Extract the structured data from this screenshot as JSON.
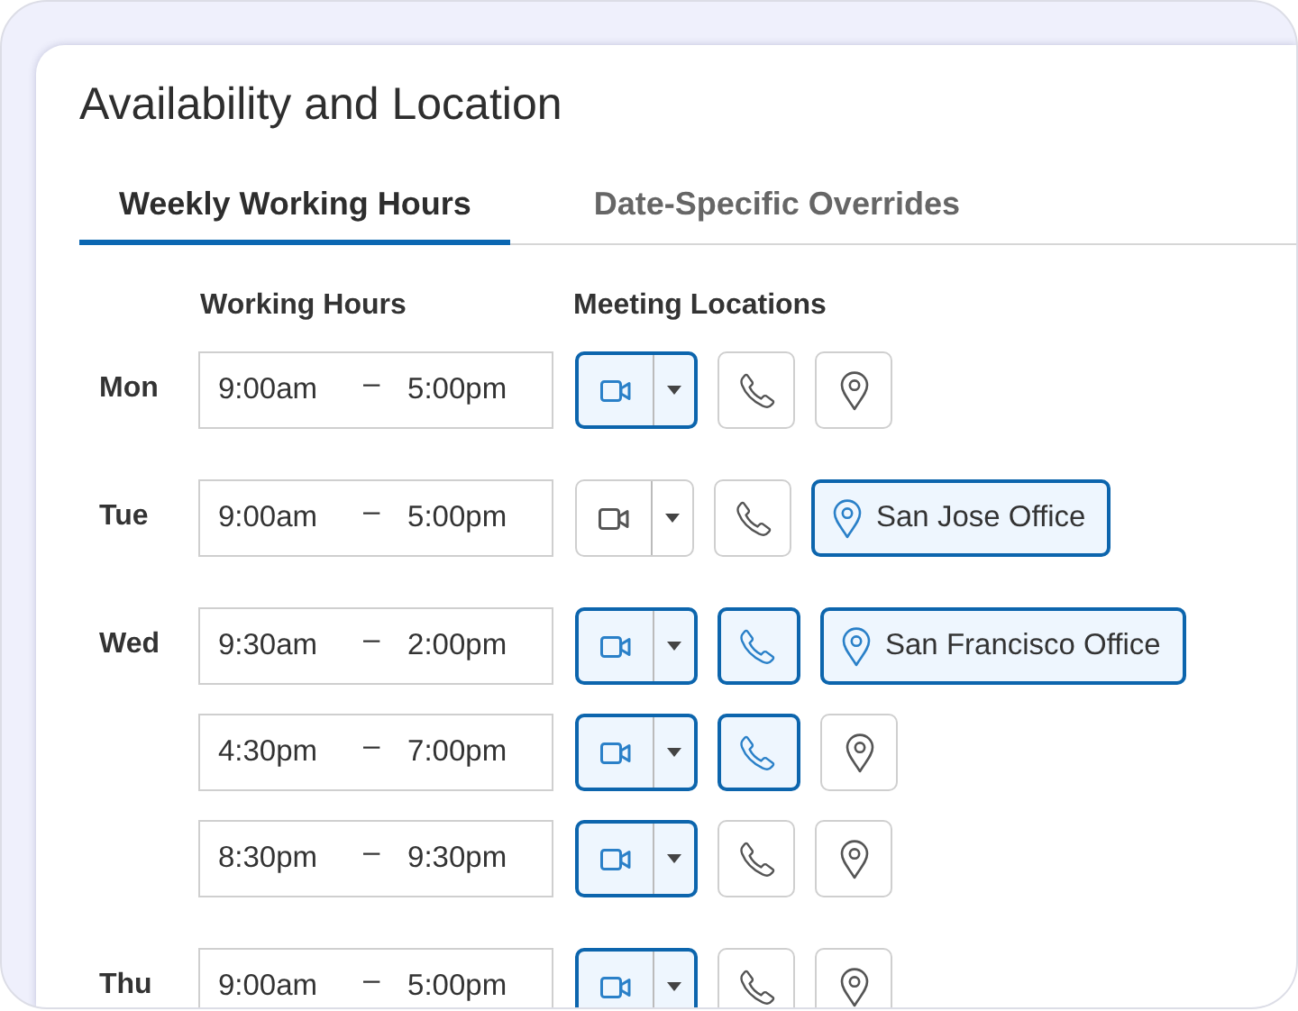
{
  "title": "Availability and Location",
  "tabs": [
    {
      "label": "Weekly Working Hours",
      "selected": true
    },
    {
      "label": "Date-Specific Overrides",
      "selected": false
    }
  ],
  "headings": {
    "hours": "Working Hours",
    "locations": "Meeting Locations"
  },
  "days": [
    {
      "label": "Mon",
      "slots": [
        {
          "start": "9:00am",
          "dash": "–",
          "end": "5:00pm",
          "video": true,
          "phone": false,
          "location": {
            "on": false
          }
        }
      ]
    },
    {
      "label": "Tue",
      "slots": [
        {
          "start": "9:00am",
          "dash": "–",
          "end": "5:00pm",
          "video": false,
          "phone": false,
          "location": {
            "on": true,
            "label": "San Jose Office"
          }
        }
      ]
    },
    {
      "label": "Wed",
      "slots": [
        {
          "start": "9:30am",
          "dash": "–",
          "end": "2:00pm",
          "video": true,
          "phone": true,
          "location": {
            "on": true,
            "label": "San Francisco Office"
          }
        },
        {
          "start": "4:30pm",
          "dash": "–",
          "end": "7:00pm",
          "video": true,
          "phone": true,
          "location": {
            "on": false
          }
        },
        {
          "start": "8:30pm",
          "dash": "–",
          "end": "9:30pm",
          "video": true,
          "phone": false,
          "location": {
            "on": false
          }
        }
      ]
    },
    {
      "label": "Thu",
      "slots": [
        {
          "start": "9:00am",
          "dash": "–",
          "end": "5:00pm",
          "video": true,
          "phone": false,
          "location": {
            "on": false
          }
        }
      ]
    }
  ]
}
